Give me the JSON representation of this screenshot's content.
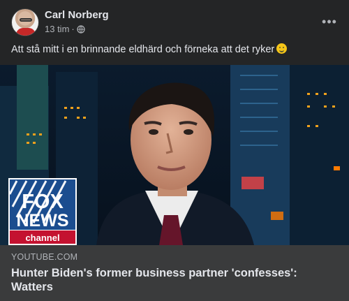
{
  "post": {
    "author": "Carl Norberg",
    "time": "13 tim",
    "separator": "·",
    "privacy_icon": "globe-icon",
    "more_icon": "more-horizontal-icon",
    "text": "Att stå mitt i en brinnande eldhärd och förneka att det ryker",
    "emoji_icon": "thinking-smile-emoji"
  },
  "link_preview": {
    "logo_line1": "FOX",
    "logo_line2": "NEWS",
    "logo_channel": "channel",
    "domain": "YOUTUBE.COM",
    "title": "Hunter Biden's former business partner 'confesses': Watters"
  },
  "colors": {
    "background": "#242526",
    "footer": "#3a3b3c",
    "text": "#e4e6eb",
    "muted": "#b0b3b8",
    "fox_blue": "#1b4d8f",
    "fox_red": "#c41230"
  }
}
